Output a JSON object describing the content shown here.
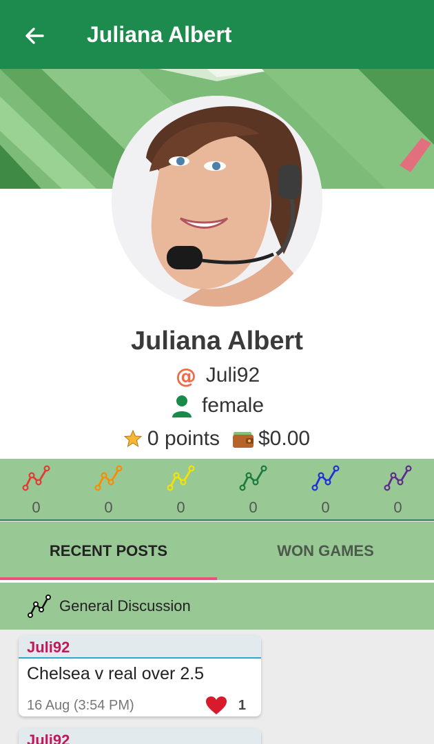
{
  "appbar": {
    "title": "Juliana Albert",
    "back_icon": "arrow-left-icon"
  },
  "profile": {
    "name": "Juliana Albert",
    "username": "Juli92",
    "gender": "female",
    "points": "0 points",
    "balance": "$0.00"
  },
  "levels": [
    {
      "color": "#e53935",
      "count": "0"
    },
    {
      "color": "#fb8c00",
      "count": "0"
    },
    {
      "color": "#f5e400",
      "count": "0"
    },
    {
      "color": "#1b7a3f",
      "count": "0"
    },
    {
      "color": "#1e2fd6",
      "count": "0"
    },
    {
      "color": "#5e2a8e",
      "count": "0"
    }
  ],
  "tabs": {
    "recent": "RECENT POSTS",
    "won": "WON GAMES"
  },
  "category": {
    "label": "General Discussion"
  },
  "posts": [
    {
      "author": "Juli92",
      "text": "Chelsea v real over 2.5",
      "date": "16 Aug  (3:54 PM)",
      "likes": "1"
    },
    {
      "author": "Juli92"
    }
  ],
  "colors": {
    "appbar": "#1e8b4e",
    "panel": "#98c894",
    "accent": "#ee4f7f",
    "author": "#c2185b"
  }
}
